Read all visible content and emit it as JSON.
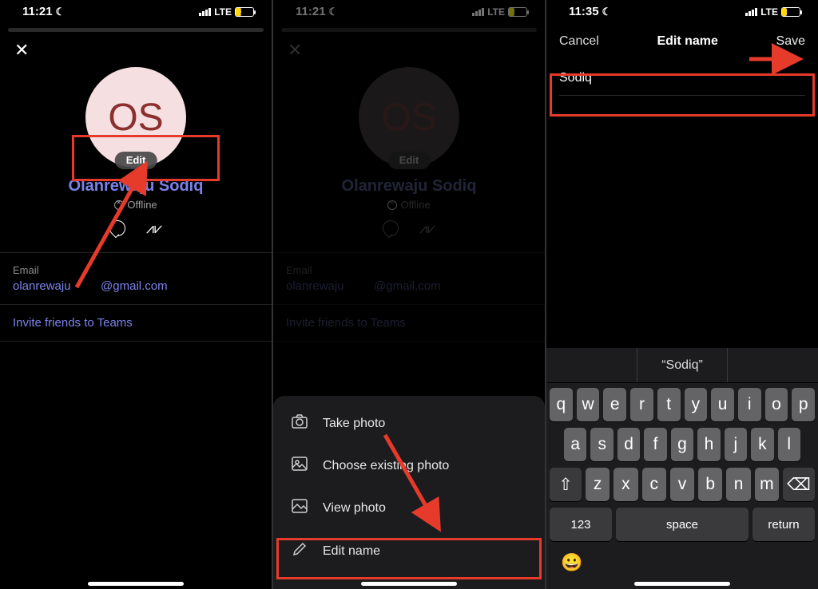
{
  "screens": [
    {
      "status": {
        "time": "11:21",
        "net": "LTE",
        "batt": "29"
      },
      "avatar_initials": "OS",
      "edit_label": "Edit",
      "display_name": "Olanrewaju Sodiq",
      "presence": "Offline",
      "email_label": "Email",
      "email_user": "olanrewaju",
      "email_domain": "@gmail.com",
      "invite_label": "Invite friends to Teams"
    },
    {
      "status": {
        "time": "11:21",
        "net": "LTE",
        "batt": "29"
      },
      "avatar_initials": "OS",
      "edit_label": "Edit",
      "display_name": "Olanrewaju Sodiq",
      "presence": "Offline",
      "email_label": "Email",
      "email_user": "olanrewaju",
      "email_domain": "@gmail.com",
      "invite_label": "Invite friends to Teams",
      "sheet": {
        "take_photo": "Take photo",
        "choose_photo": "Choose existing photo",
        "view_photo": "View photo",
        "edit_name": "Edit name"
      }
    },
    {
      "status": {
        "time": "11:35",
        "net": "LTE",
        "batt": "27"
      },
      "nav": {
        "cancel": "Cancel",
        "title": "Edit name",
        "save": "Save"
      },
      "name_value": "Sodiq",
      "keyboard": {
        "suggestion": "“Sodiq”",
        "row1": [
          "q",
          "w",
          "e",
          "r",
          "t",
          "y",
          "u",
          "i",
          "o",
          "p"
        ],
        "row2": [
          "a",
          "s",
          "d",
          "f",
          "g",
          "h",
          "j",
          "k",
          "l"
        ],
        "row3": [
          "z",
          "x",
          "c",
          "v",
          "b",
          "n",
          "m"
        ],
        "shift": "⇧",
        "backspace": "⌫",
        "numkey": "123",
        "space": "space",
        "return": "return",
        "emoji": "😀"
      }
    }
  ]
}
